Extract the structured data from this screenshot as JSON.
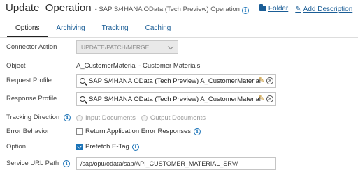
{
  "header": {
    "title": "Update_Operation",
    "subtitle": "- SAP S/4HANA OData (Tech Preview) Operation",
    "folder_link": "Folder",
    "add_description_link": "Add Description"
  },
  "tabs": [
    {
      "label": "Options",
      "active": true
    },
    {
      "label": "Archiving",
      "active": false
    },
    {
      "label": "Tracking",
      "active": false
    },
    {
      "label": "Caching",
      "active": false
    }
  ],
  "form": {
    "connector_action": {
      "label": "Connector Action",
      "value": "UPDATE/PATCH/MERGE"
    },
    "object": {
      "label": "Object",
      "value": "A_CustomerMaterial - Customer Materials"
    },
    "request_profile": {
      "label": "Request Profile",
      "value": "SAP S/4HANA OData (Tech Preview) A_CustomerMaterial"
    },
    "response_profile": {
      "label": "Response Profile",
      "value": "SAP S/4HANA OData (Tech Preview) A_CustomerMaterial"
    },
    "tracking_direction": {
      "label": "Tracking Direction",
      "options": [
        "Input Documents",
        "Output Documents"
      ]
    },
    "error_behavior": {
      "label": "Error Behavior",
      "checkbox_label": "Return Application Error Responses",
      "checked": false
    },
    "option": {
      "label": "Option",
      "checkbox_label": "Prefetch E-Tag",
      "checked": true
    },
    "service_url_path": {
      "label": "Service URL Path",
      "value": "/sap/opu/odata/sap/API_CUSTOMER_MATERIAL_SRV/"
    }
  },
  "icons": {
    "info": "info-icon",
    "folder": "folder-icon",
    "pencil": "pencil-icon",
    "search": "search-icon",
    "clear": "clear-icon"
  },
  "colors": {
    "link": "#1a5d96",
    "info": "#1a73b8",
    "edit": "#c48a16"
  }
}
